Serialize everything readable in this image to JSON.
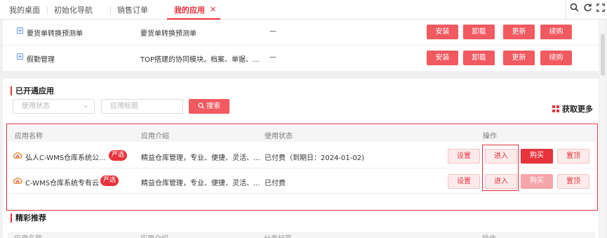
{
  "tabs": [
    {
      "label": "我的桌面",
      "active": false
    },
    {
      "label": "初始化导航",
      "active": false
    },
    {
      "label": "销售订单",
      "active": false
    },
    {
      "label": "我的应用",
      "active": true
    }
  ],
  "toolbar": {
    "search_icon": "search-icon",
    "refresh_icon": "refresh-icon",
    "fullscreen_icon": "fullscreen-icon"
  },
  "install_list": [
    {
      "name": "要货单转换预测单",
      "desc": "要货单转换预测单",
      "status": "—",
      "btn_install": "安装",
      "btn_uninstall": "卸载",
      "btn_update": "更新",
      "btn_renew": "续购"
    },
    {
      "name": "假勤管理",
      "desc": "TOP搭建的协同模块。档案、单据、...",
      "status": "—",
      "btn_install": "安装",
      "btn_uninstall": "卸载",
      "btn_update": "更新",
      "btn_renew": "续购"
    }
  ],
  "opened": {
    "title": "已开通应用",
    "status_select_placeholder": "使用状态",
    "title_input_placeholder": "应用标题",
    "search_label": "搜索",
    "more_label": "获取更多",
    "columns": {
      "name": "应用名称",
      "intro": "应用介绍",
      "status": "使用状态",
      "ops": "操作"
    },
    "rows": [
      {
        "name": "弘人C-WMS仓库系统公...",
        "badge": "严选",
        "intro": "精益仓库管理，专业、便捷、灵活、...",
        "status": "已付费（到期日：2024-01-02)",
        "settings": "设置",
        "enter": "进入",
        "buy": "购买",
        "pin": "置顶"
      },
      {
        "name": "C-WMS仓库系统专有云",
        "badge": "严选",
        "intro": "精益仓库管理，专业、便捷、灵活、...",
        "status": "已付费",
        "settings": "设置",
        "enter": "进入",
        "buy": "购买",
        "pin": "置顶"
      }
    ]
  },
  "recommend": {
    "title": "精彩推荐",
    "columns": {
      "name": "应用名称",
      "intro": "应用介绍",
      "category": "分类标签",
      "ops": "操作"
    }
  },
  "colors": {
    "accent": "#e8323c",
    "button": "#f15a61"
  }
}
